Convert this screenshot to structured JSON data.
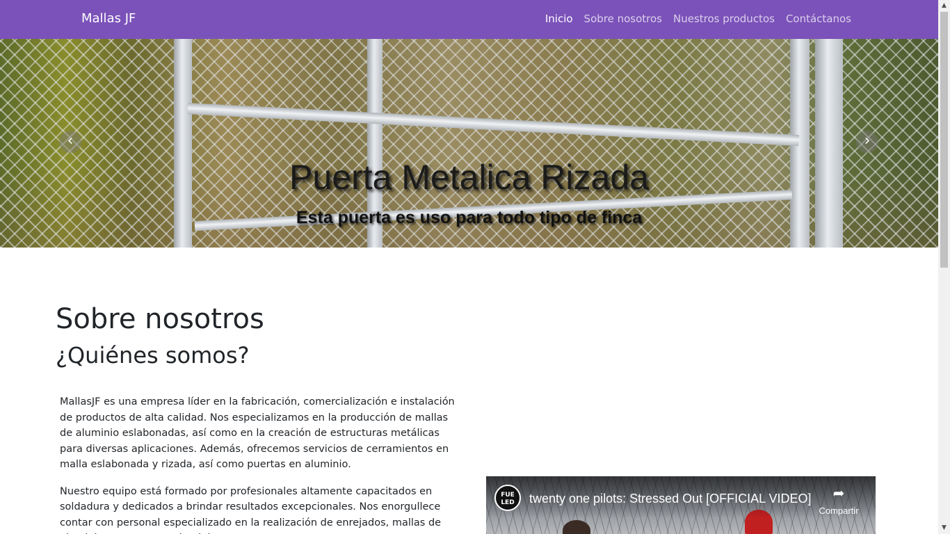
{
  "navbar": {
    "brand": "Mallas JF",
    "items": [
      {
        "label": "Inicio",
        "active": true
      },
      {
        "label": "Sobre nosotros",
        "active": false
      },
      {
        "label": "Nuestros productos",
        "active": false
      },
      {
        "label": "Contáctanos",
        "active": false
      }
    ]
  },
  "carousel": {
    "title": "Puerta Metalica Rizada",
    "subtitle": "Esta puerta es uso para todo tipo de finca",
    "prev_icon": "chevron-left-icon",
    "next_icon": "chevron-right-icon"
  },
  "about": {
    "title": "Sobre nosotros",
    "subtitle": "¿Quiénes somos?",
    "paragraphs": [
      "MallasJF es una empresa líder en la fabricación, comercialización e instalación de productos de alta calidad. Nos especializamos en la producción de mallas de aluminio eslabonadas, así como en la creación de estructuras metálicas para diversas aplicaciones. Además, ofrecemos servicios de cerramientos en malla eslabonada y rizada, así como puertas en aluminio.",
      "Nuestro equipo está formado por profesionales altamente capacitados en soldadura y dedicados a brindar resultados excepcionales. Nos enorgullece contar con personal especializado en la realización de enrejados, mallas de aluminio y puertas en aluminio,"
    ]
  },
  "video": {
    "title": "twenty one pilots: Stressed Out [OFFICIAL VIDEO]",
    "channel_logo_text": "FUE LED",
    "share_label": "Compartir",
    "share_icon": "share-arrow-icon"
  },
  "colors": {
    "navbar_bg": "#7b52b9",
    "nav_text": "#ffffff"
  }
}
